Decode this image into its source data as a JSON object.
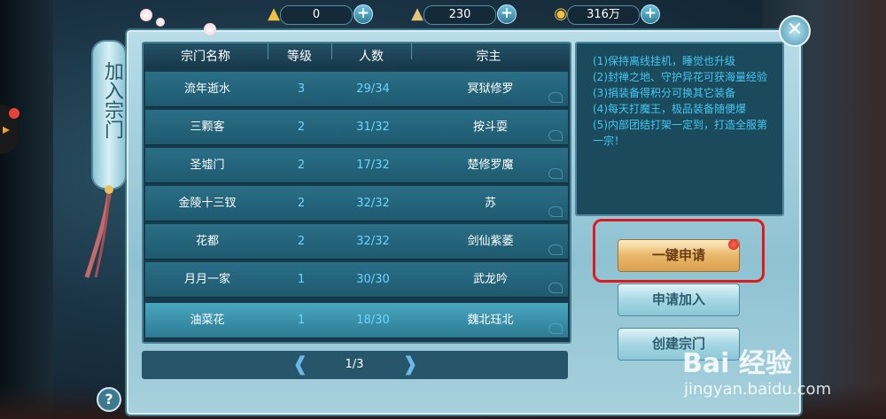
{
  "resources": [
    {
      "icon": "gold-ingot-icon",
      "value": "0"
    },
    {
      "icon": "silver-ingot-icon",
      "value": "230"
    },
    {
      "icon": "coin-icon",
      "value": "316万"
    }
  ],
  "panel": {
    "vertical_title": "加入宗门"
  },
  "table": {
    "headers": [
      "宗门名称",
      "等级",
      "人数",
      "宗主"
    ],
    "rows": [
      {
        "name": "流年逝水",
        "level": "3",
        "members": "29/34",
        "leader": "冥狱修罗",
        "selected": false
      },
      {
        "name": "三颗客",
        "level": "2",
        "members": "31/32",
        "leader": "按斗耍",
        "selected": false
      },
      {
        "name": "圣墟门",
        "level": "2",
        "members": "17/32",
        "leader": "楚修罗魔",
        "selected": false
      },
      {
        "name": "金陵十三钗",
        "level": "2",
        "members": "32/32",
        "leader": "苏",
        "selected": false
      },
      {
        "name": "花都",
        "level": "2",
        "members": "32/32",
        "leader": "剑仙紫萎",
        "selected": false
      },
      {
        "name": "月月一家",
        "level": "1",
        "members": "30/30",
        "leader": "武龙吟",
        "selected": false
      },
      {
        "name": "油菜花",
        "level": "1",
        "members": "18/30",
        "leader": "魏北珏北",
        "selected": true
      }
    ]
  },
  "pager": {
    "text": "1/3"
  },
  "rules": [
    "(1)保持离线挂机，睡觉也升级",
    "(2)封禅之地、守护异花可获海量经验",
    "(3)捐装备得积分可换其它装备",
    "(4)每天打魔王，极品装备随便爆",
    "(5)内部团结打架一定到，打造全服第一宗！"
  ],
  "buttons": {
    "one_click_apply": "一键申请",
    "apply_join": "申请加入",
    "create_sect": "创建宗门"
  },
  "help_label": "?",
  "watermark": {
    "brand": "Bai 经验",
    "url": "jingyan.baidu.com"
  },
  "colors": {
    "highlight": "#e0191c",
    "level_text": "#6fd3ff",
    "rules_text": "#44c7f0"
  }
}
